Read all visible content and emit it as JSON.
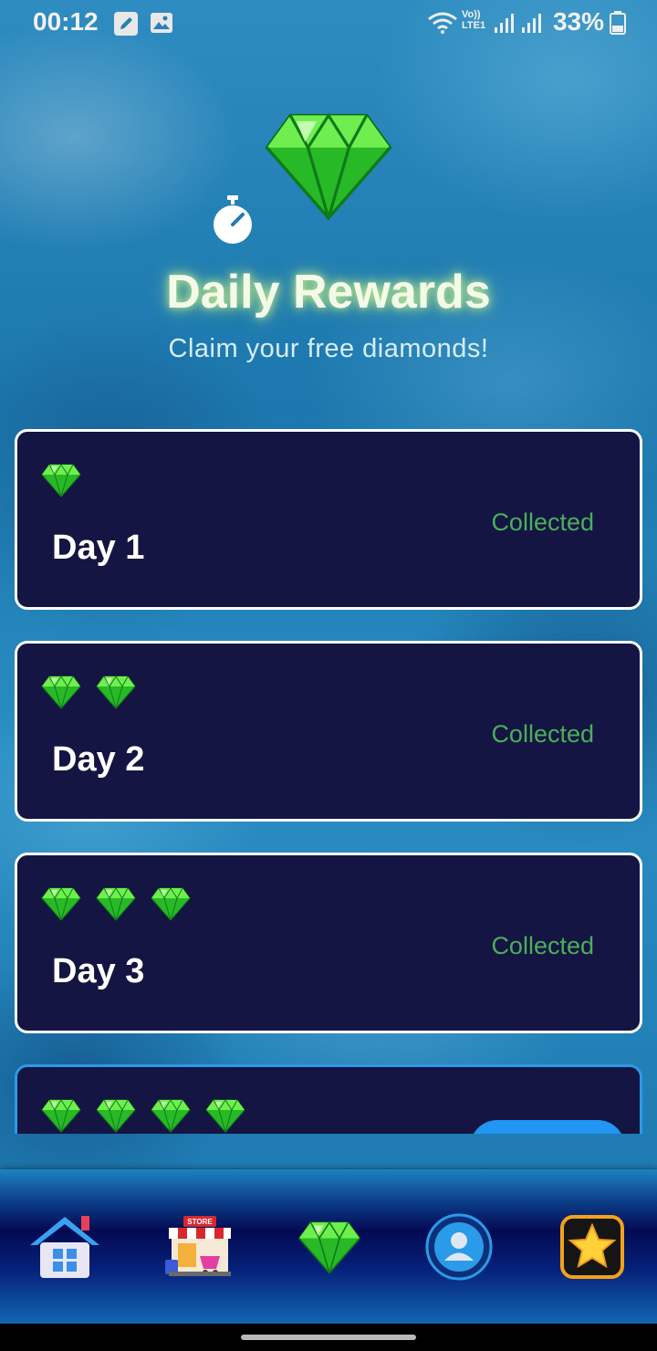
{
  "status_bar": {
    "time": "00:12",
    "network_label": "Vo))\nLTE1",
    "battery": "33%"
  },
  "header": {
    "title": "Daily Rewards",
    "subtitle": "Claim your free diamonds!",
    "gem_icon": "diamond-icon",
    "timer_icon": "stopwatch-icon"
  },
  "rewards": [
    {
      "day_label": "Day 1",
      "gems": 1,
      "status": "Collected"
    },
    {
      "day_label": "Day 2",
      "gems": 2,
      "status": "Collected"
    },
    {
      "day_label": "Day 3",
      "gems": 3,
      "status": "Collected"
    },
    {
      "day_label": "",
      "gems": 4,
      "status": ""
    }
  ],
  "bottom_nav": {
    "items": [
      {
        "name": "home",
        "icon": "home-icon"
      },
      {
        "name": "store",
        "icon": "store-icon",
        "badge_text": "STORE"
      },
      {
        "name": "diamonds",
        "icon": "diamond-icon"
      },
      {
        "name": "profile",
        "icon": "profile-icon"
      },
      {
        "name": "favorites",
        "icon": "star-icon"
      }
    ]
  },
  "colors": {
    "card_bg": "#141542",
    "collected": "#4cae5a",
    "claim_button": "#2196f3",
    "title_glow": "#e6ff8c"
  }
}
